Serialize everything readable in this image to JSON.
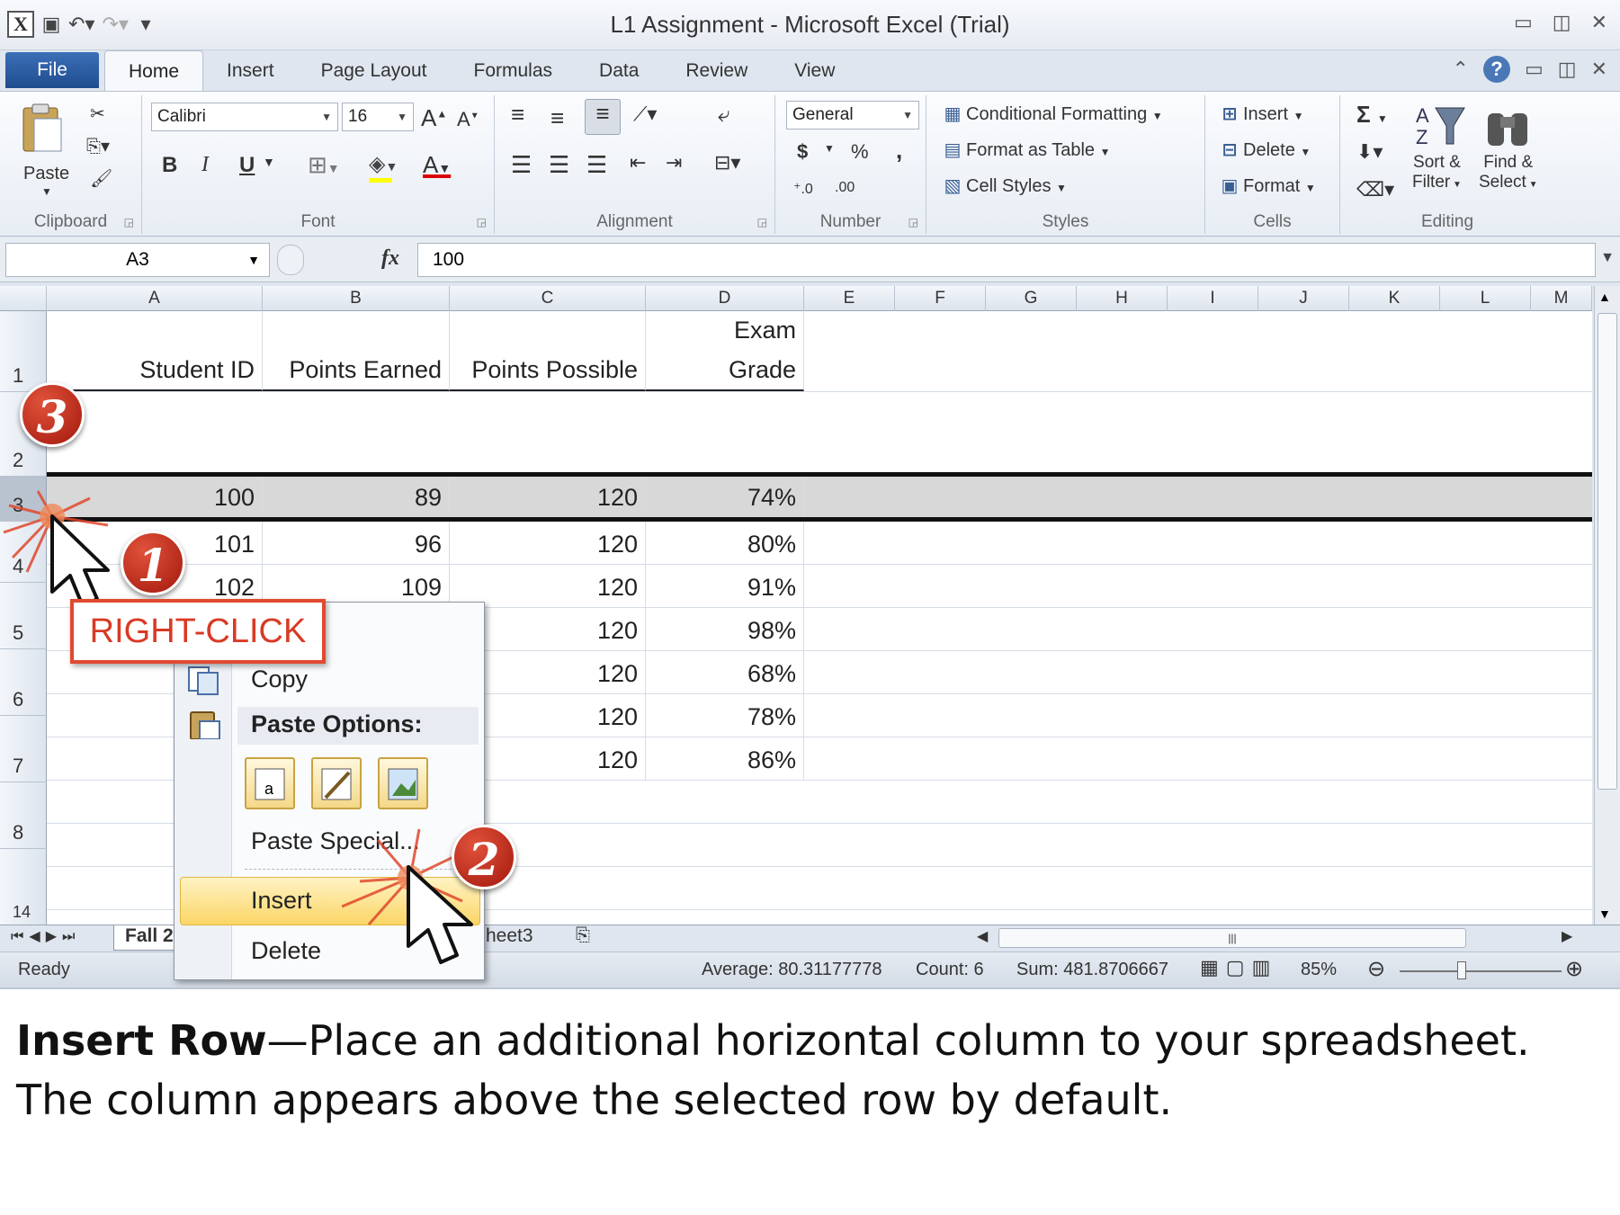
{
  "window": {
    "title": "L1 Assignment  -  Microsoft Excel (Trial)"
  },
  "ribbon_tabs": {
    "file": "File",
    "tabs": [
      "Home",
      "Insert",
      "Page Layout",
      "Formulas",
      "Data",
      "Review",
      "View"
    ],
    "active": "Home"
  },
  "ribbon": {
    "clipboard": {
      "label": "Clipboard",
      "paste": "Paste"
    },
    "font": {
      "label": "Font",
      "font_name": "Calibri",
      "font_size": "16",
      "bold": "B",
      "italic": "I",
      "underline": "U"
    },
    "alignment": {
      "label": "Alignment"
    },
    "number": {
      "label": "Number",
      "format": "General",
      "currency": "$",
      "percent": "%",
      "comma": ","
    },
    "styles": {
      "label": "Styles",
      "conditional": "Conditional Formatting",
      "format_table": "Format as Table",
      "cell_styles": "Cell Styles"
    },
    "cells": {
      "label": "Cells",
      "insert": "Insert",
      "delete": "Delete",
      "format": "Format"
    },
    "editing": {
      "label": "Editing",
      "sigma": "Σ",
      "sort": "Sort &",
      "filter": "Filter",
      "find": "Find &",
      "select": "Select"
    }
  },
  "formula_bar": {
    "name_box": "A3",
    "fx": "fx",
    "value": "100"
  },
  "columns": [
    "A",
    "B",
    "C",
    "D",
    "E",
    "F",
    "G",
    "H",
    "I",
    "J",
    "K",
    "L",
    "M"
  ],
  "headers": {
    "student_id": "Student ID",
    "points_earned": "Points Earned",
    "points_possible": "Points Possible",
    "exam_line1": "Exam",
    "exam_line2": "Grade"
  },
  "row_numbers": [
    "1",
    "2",
    "3",
    "4",
    "5",
    "6",
    "7",
    "8",
    "14"
  ],
  "rows": [
    {
      "a": "100",
      "b": "89",
      "c": "120",
      "d": "74%"
    },
    {
      "a": "101",
      "b": "96",
      "c": "120",
      "d": "80%"
    },
    {
      "a": "102",
      "b": "109",
      "c": "120",
      "d": "91%"
    },
    {
      "a": "",
      "b": "",
      "c": "120",
      "d": "98%"
    },
    {
      "a": "",
      "b": "",
      "c": "120",
      "d": "68%"
    },
    {
      "a": "",
      "b": "",
      "c": "120",
      "d": "78%"
    },
    {
      "a": "",
      "b": "",
      "c": "120",
      "d": "86%"
    }
  ],
  "sheet_tabs": {
    "first": "Fall 2",
    "third": "heet3"
  },
  "status": {
    "ready": "Ready",
    "average": "Average: 80.31177778",
    "count": "Count: 6",
    "sum": "Sum: 481.8706667",
    "zoom": "85%"
  },
  "context_menu": {
    "copy": "Copy",
    "paste_options": "Paste Options:",
    "paste_special": "Paste Special...",
    "insert": "Insert",
    "delete": "Delete"
  },
  "callouts": {
    "step1": "1",
    "step2": "2",
    "step3": "3",
    "right_click": "RIGHT-CLICK"
  },
  "caption": {
    "bold": "Insert Row",
    "text": "—Place an additional horizontal column to your spreadsheet.  The column appears above the selected row by default."
  },
  "colors": {
    "accent": "#2b579a",
    "callout_red": "#c0281a",
    "selection_gray": "#d8d8d8",
    "menu_highlight": "#fbd666"
  }
}
